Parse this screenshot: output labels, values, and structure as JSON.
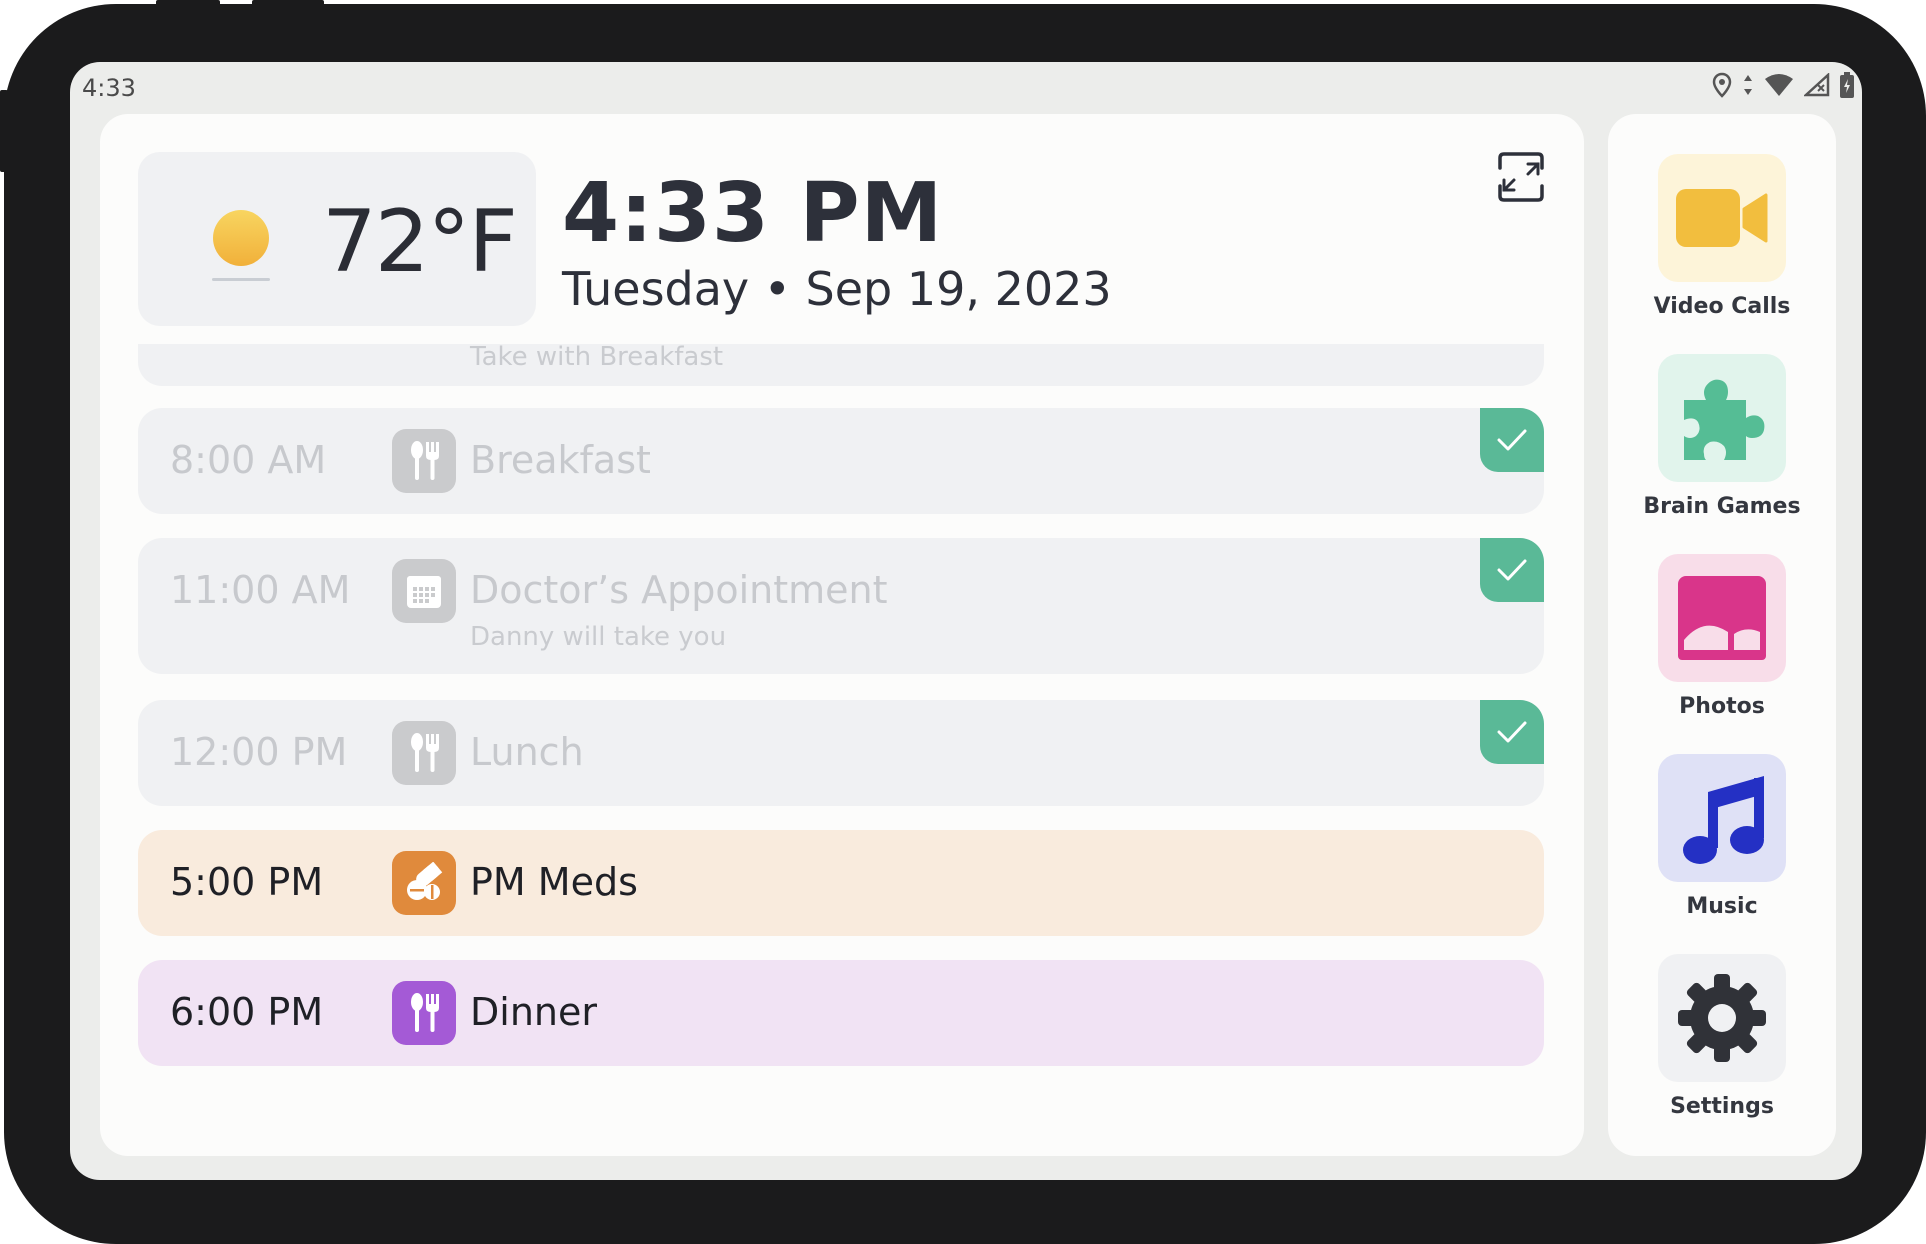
{
  "status_bar": {
    "time": "4:33",
    "icons": [
      "location-icon",
      "data-arrows-icon",
      "wifi-icon",
      "cellular-icon",
      "battery-icon"
    ]
  },
  "weather": {
    "temperature": "72°F",
    "condition_icon": "sun-icon"
  },
  "clock": {
    "time": "4:33 PM",
    "date": "Tuesday • Sep 19, 2023"
  },
  "schedule": {
    "partial_item_subtitle": "Take with Breakfast",
    "items": [
      {
        "time": "8:00 AM",
        "title": "Breakfast",
        "subtitle": "",
        "icon": "utensils-icon",
        "done": true
      },
      {
        "time": "11:00 AM",
        "title": "Doctor’s Appointment",
        "subtitle": "Danny will take you",
        "icon": "calendar-icon",
        "done": true
      },
      {
        "time": "12:00 PM",
        "title": "Lunch",
        "subtitle": "",
        "icon": "utensils-icon",
        "done": true
      },
      {
        "time": "5:00 PM",
        "title": "PM Meds",
        "subtitle": "",
        "icon": "pills-icon",
        "done": false
      },
      {
        "time": "6:00 PM",
        "title": "Dinner",
        "subtitle": "",
        "icon": "utensils-icon",
        "done": false
      }
    ]
  },
  "apps": [
    {
      "label": "Video Calls",
      "icon": "video-camera-icon"
    },
    {
      "label": "Brain Games",
      "icon": "puzzle-icon"
    },
    {
      "label": "Photos",
      "icon": "photo-icon"
    },
    {
      "label": "Music",
      "icon": "music-note-icon"
    },
    {
      "label": "Settings",
      "icon": "gear-icon"
    }
  ],
  "colors": {
    "check_green": "#5ab997",
    "meds_bg": "#f9ebdd",
    "meds_icon": "#e08a3c",
    "dinner_bg": "#f1e3f4",
    "dinner_icon": "#a45ad6",
    "video_tile": "#fdf4d9",
    "games_tile": "#e1f4ec",
    "photos_tile": "#f8dde9",
    "music_tile": "#dfe1f6",
    "settings_tile": "#f0f1f3"
  }
}
